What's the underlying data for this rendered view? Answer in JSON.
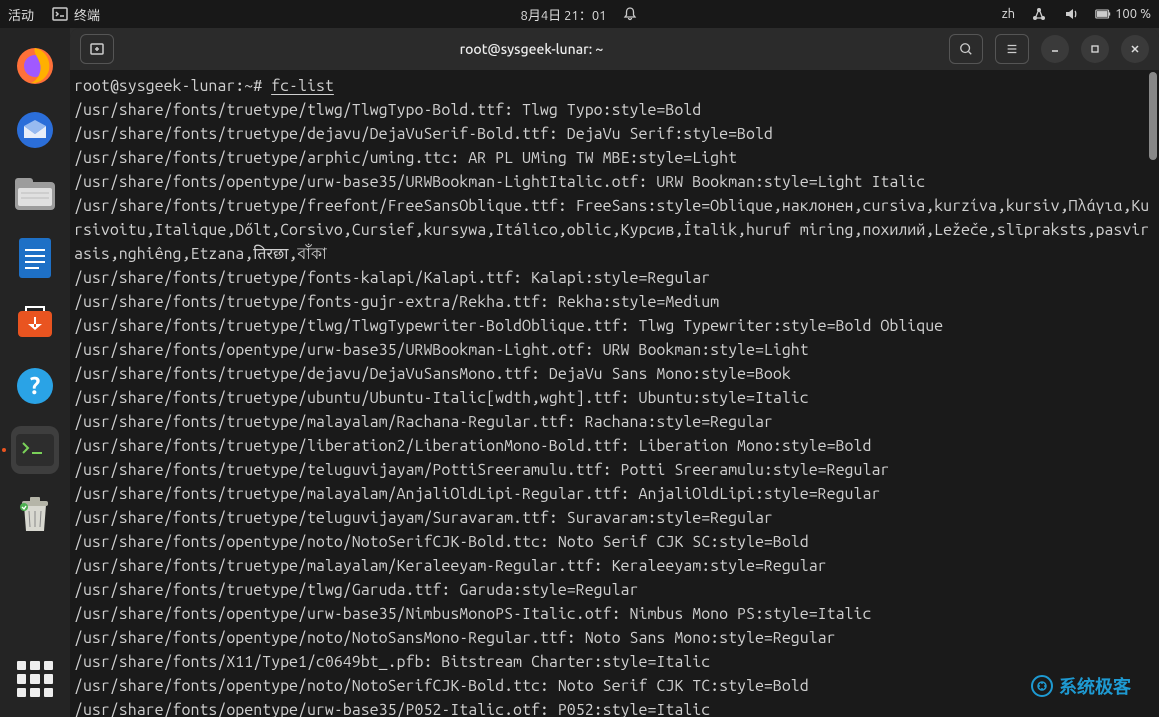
{
  "top_panel": {
    "activities": "活动",
    "app_label": "终端",
    "datetime": "8月4日 21：01",
    "lang": "zh",
    "battery": "100 %"
  },
  "window": {
    "title": "root@sysgeek-lunar: ~"
  },
  "terminal": {
    "prompt": "root@sysgeek-lunar:~#",
    "command": "fc-list",
    "output": [
      "/usr/share/fonts/truetype/tlwg/TlwgTypo-Bold.ttf: Tlwg Typo:style=Bold",
      "/usr/share/fonts/truetype/dejavu/DejaVuSerif-Bold.ttf: DejaVu Serif:style=Bold",
      "/usr/share/fonts/truetype/arphic/uming.ttc: AR PL UMing TW MBE:style=Light",
      "/usr/share/fonts/opentype/urw-base35/URWBookman-LightItalic.otf: URW Bookman:style=Light Italic",
      "/usr/share/fonts/truetype/freefont/FreeSansOblique.ttf: FreeSans:style=Oblique,наклонен,cursiva,kurzíva,kursiv,Πλάγια,Kursivoitu,Italique,Dőlt,Corsivo,Cursief,kursywa,Itálico,oblic,Курсив,İtalik,huruf miring,похилий,Ležeče,slīpraksts,pasvirasis,nghiêng,Etzana,तिरछा,বাঁকা",
      "/usr/share/fonts/truetype/fonts-kalapi/Kalapi.ttf: Kalapi:style=Regular",
      "/usr/share/fonts/truetype/fonts-gujr-extra/Rekha.ttf: Rekha:style=Medium",
      "/usr/share/fonts/truetype/tlwg/TlwgTypewriter-BoldOblique.ttf: Tlwg Typewriter:style=Bold Oblique",
      "/usr/share/fonts/opentype/urw-base35/URWBookman-Light.otf: URW Bookman:style=Light",
      "/usr/share/fonts/truetype/dejavu/DejaVuSansMono.ttf: DejaVu Sans Mono:style=Book",
      "/usr/share/fonts/truetype/ubuntu/Ubuntu-Italic[wdth,wght].ttf: Ubuntu:style=Italic",
      "/usr/share/fonts/truetype/malayalam/Rachana-Regular.ttf: Rachana:style=Regular",
      "/usr/share/fonts/truetype/liberation2/LiberationMono-Bold.ttf: Liberation Mono:style=Bold",
      "/usr/share/fonts/truetype/teluguvijayam/PottiSreeramulu.ttf: Potti Sreeramulu:style=Regular",
      "/usr/share/fonts/truetype/malayalam/AnjaliOldLipi-Regular.ttf: AnjaliOldLipi:style=Regular",
      "/usr/share/fonts/truetype/teluguvijayam/Suravaram.ttf: Suravaram:style=Regular",
      "/usr/share/fonts/opentype/noto/NotoSerifCJK-Bold.ttc: Noto Serif CJK SC:style=Bold",
      "/usr/share/fonts/truetype/malayalam/Keraleeyam-Regular.ttf: Keraleeyam:style=Regular",
      "/usr/share/fonts/truetype/tlwg/Garuda.ttf: Garuda:style=Regular",
      "/usr/share/fonts/opentype/urw-base35/NimbusMonoPS-Italic.otf: Nimbus Mono PS:style=Italic",
      "/usr/share/fonts/opentype/noto/NotoSansMono-Regular.ttf: Noto Sans Mono:style=Regular",
      "/usr/share/fonts/X11/Type1/c0649bt_.pfb: Bitstream Charter:style=Italic",
      "/usr/share/fonts/opentype/noto/NotoSerifCJK-Bold.ttc: Noto Serif CJK TC:style=Bold",
      "/usr/share/fonts/opentype/urw-base35/P052-Italic.otf: P052:style=Italic"
    ]
  },
  "watermark": "系统极客"
}
